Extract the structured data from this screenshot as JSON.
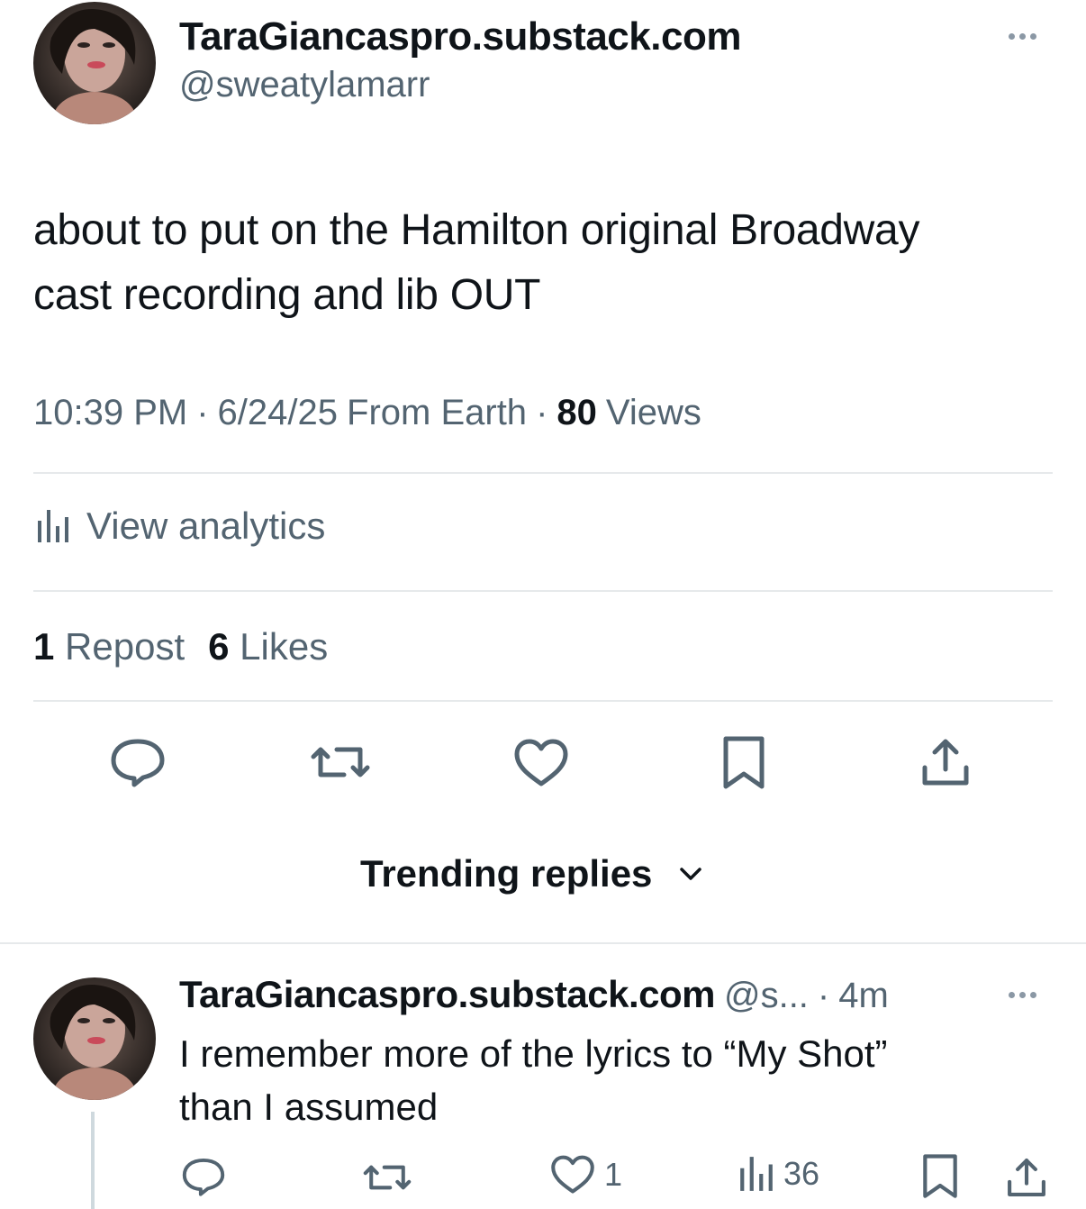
{
  "post": {
    "display_name": "TaraGiancaspro.substack.com",
    "handle": "@sweatylamarr",
    "text_line1": "about to put on the Hamilton original Broadway",
    "text_line2": "cast recording and lib OUT",
    "time": "10:39 PM",
    "sep1": "·",
    "date": "6/24/25",
    "source": "From Earth",
    "sep2": "·",
    "views_count": "80",
    "views_label": "Views",
    "analytics_label": "View analytics",
    "reposts_count": "1",
    "reposts_label": "Repost",
    "likes_count": "6",
    "likes_label": "Likes"
  },
  "replies_header": {
    "label": "Trending replies"
  },
  "reply": {
    "display_name": "TaraGiancaspro.substack.com",
    "handle": "@s...",
    "sep": "·",
    "age": "4m",
    "text_line1": "I remember more of the lyrics to “My Shot”",
    "text_line2": "than I assumed",
    "likes_count": "1",
    "views_count": "36"
  },
  "colors": {
    "text": "#0f1419",
    "muted": "#536471",
    "divider": "#e6e9eb",
    "dots": "#8b98a5"
  },
  "icons": [
    "avatar",
    "more-icon",
    "analytics-icon",
    "reply-icon",
    "repost-icon",
    "like-icon",
    "bookmark-icon",
    "share-icon",
    "chevron-down-icon"
  ]
}
